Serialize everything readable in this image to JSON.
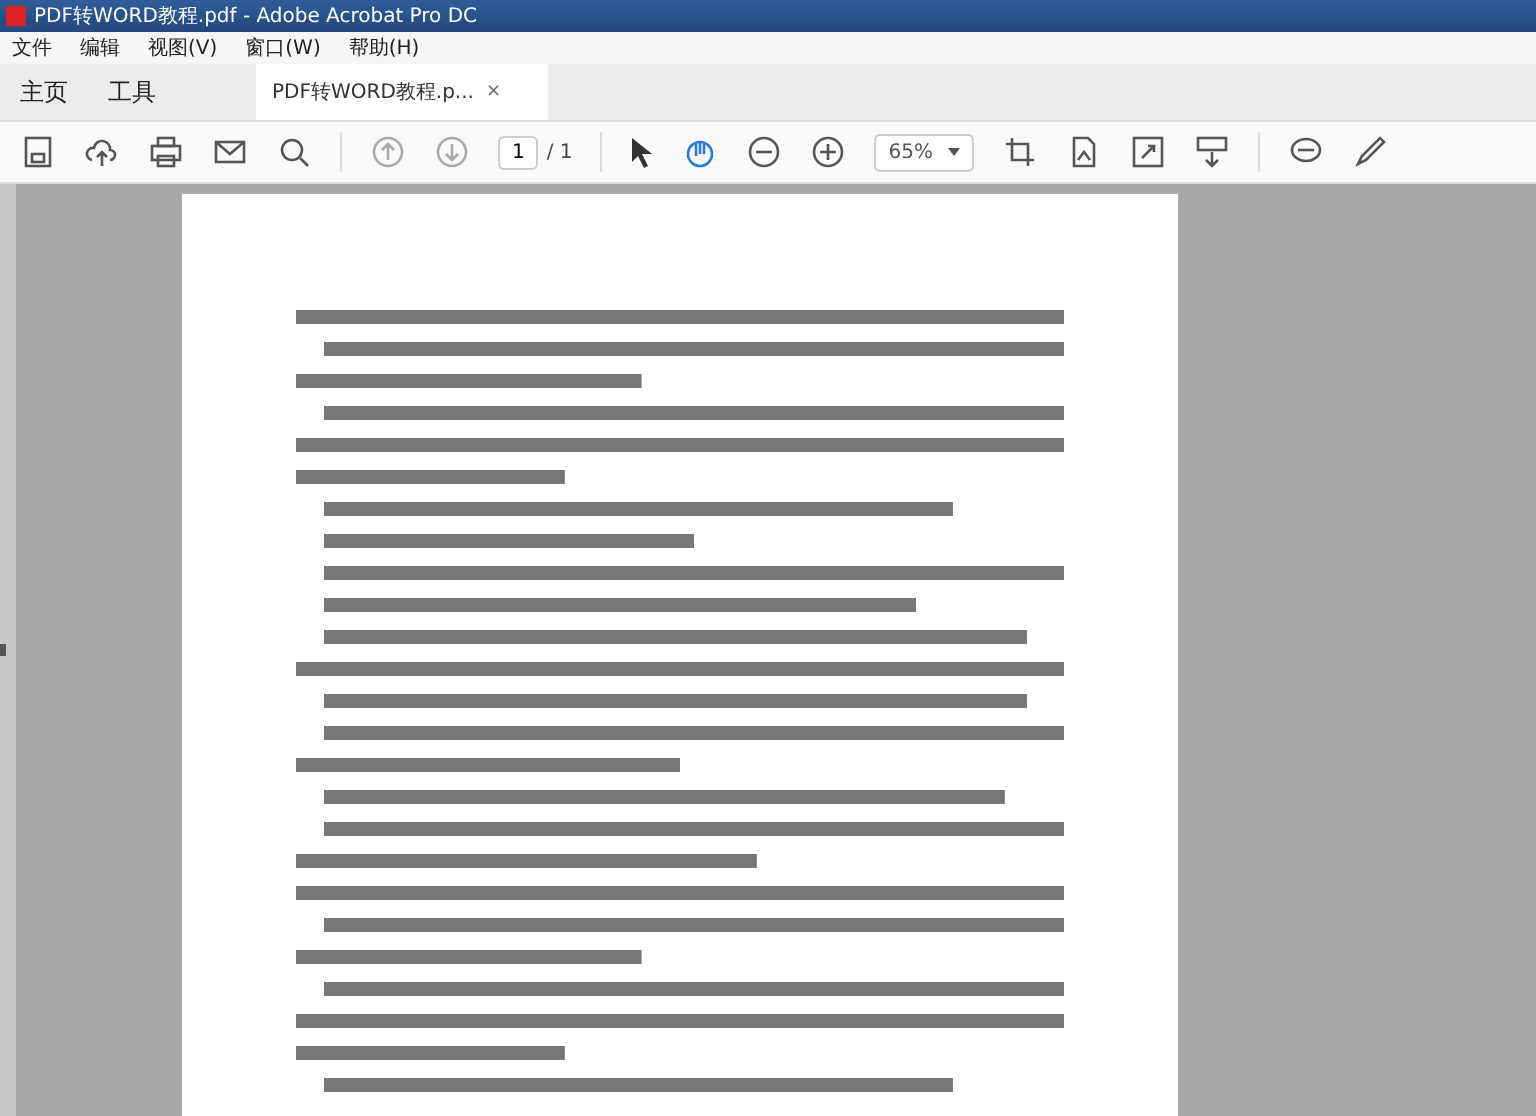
{
  "window": {
    "title": "PDF转WORD教程.pdf - Adobe Acrobat Pro DC"
  },
  "menu": [
    "文件",
    "编辑",
    "视图(V)",
    "窗口(W)",
    "帮助(H)"
  ],
  "nav_tabs": [
    {
      "label": "主页",
      "selected": false
    },
    {
      "label": "工具",
      "selected": false
    }
  ],
  "document_tab": {
    "label": "PDF转WORD教程.p...",
    "close": "×"
  },
  "toolbar": {
    "page_current": "1",
    "page_total": "/ 1",
    "zoom": "65%",
    "hand_tool_selected": true
  }
}
